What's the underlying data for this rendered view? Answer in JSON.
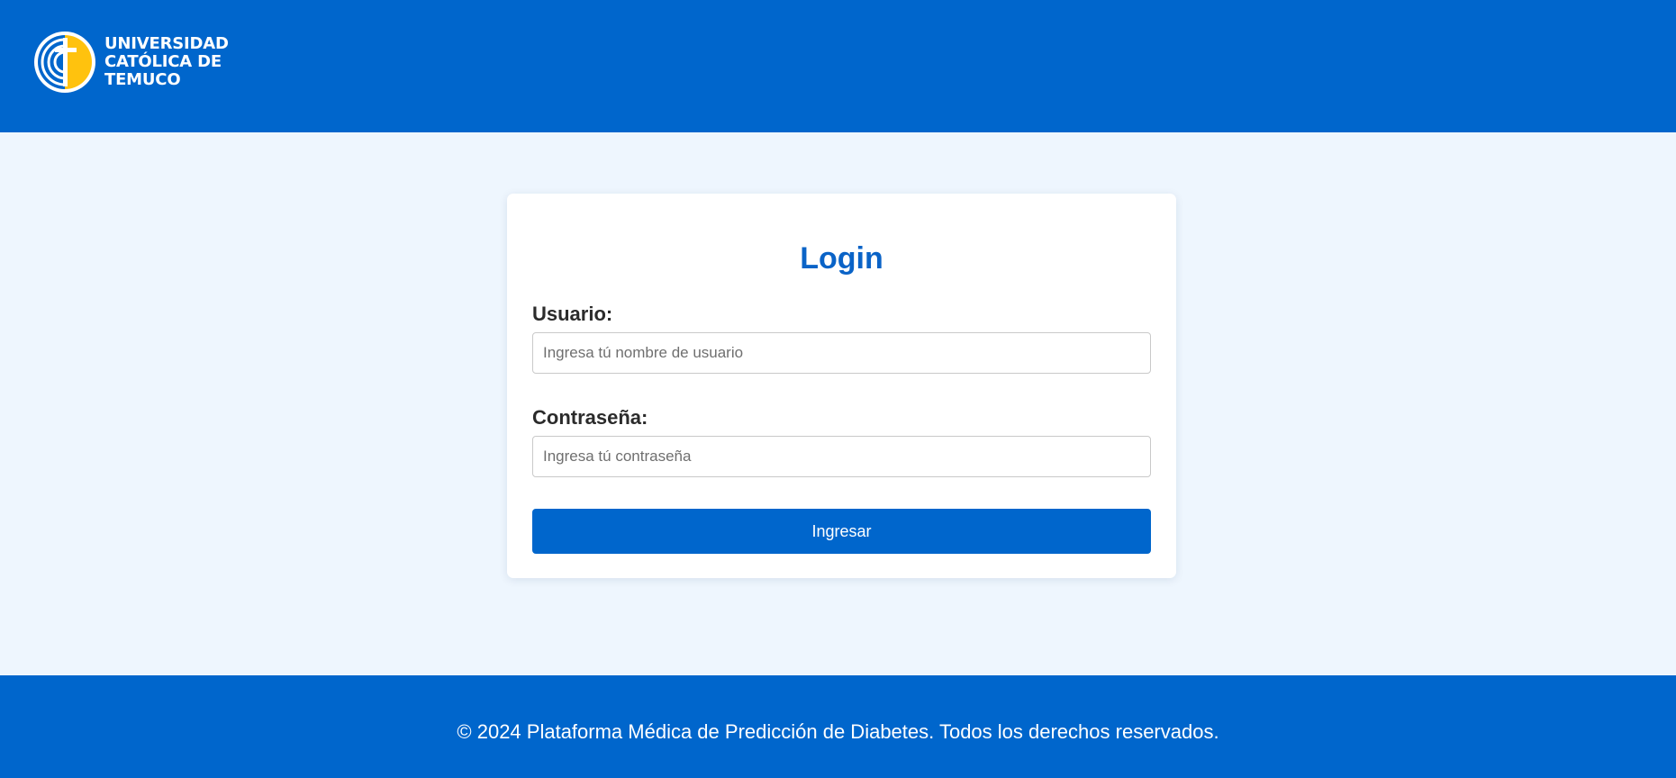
{
  "header": {
    "logo_lines": [
      "UNIVERSIDAD",
      "CATÓLICA DE",
      "TEMUCO"
    ]
  },
  "login": {
    "title": "Login",
    "username_label": "Usuario:",
    "username_placeholder": "Ingresa tú nombre de usuario",
    "username_value": "",
    "password_label": "Contraseña:",
    "password_placeholder": "Ingresa tú contraseña",
    "password_value": "",
    "submit_label": "Ingresar"
  },
  "footer": {
    "text": "© 2024 Plataforma Médica de Predicción de Diabetes. Todos los derechos reservados."
  },
  "colors": {
    "brand_blue": "#0066cc",
    "title_blue": "#0a63c7",
    "page_background": "#eef6fe",
    "logo_yellow": "#ffc20e"
  },
  "icons": {
    "logo": "university-seal-icon"
  }
}
